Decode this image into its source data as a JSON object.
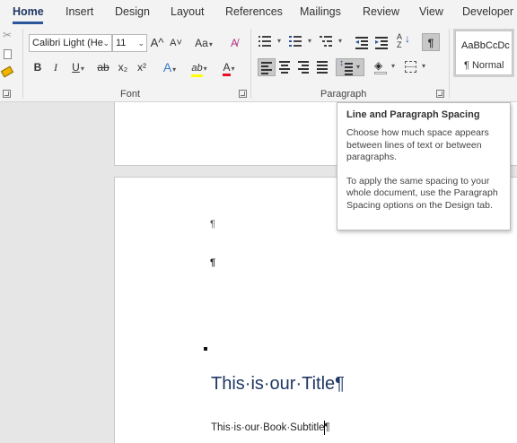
{
  "tabs": [
    "Home",
    "Insert",
    "Design",
    "Layout",
    "References",
    "Mailings",
    "Review",
    "View",
    "Developer"
  ],
  "active_tab": "Home",
  "ribbon": {
    "font": {
      "label": "Font",
      "name_value": "Calibri Light (He",
      "size_value": "11",
      "grow_label": "A^",
      "shrink_label": "A˅",
      "case_label": "Aa",
      "bold": "B",
      "italic": "I",
      "underline": "U",
      "strikethrough": "ab",
      "subscript": "x₂",
      "superscript": "x²",
      "effects": "A",
      "highlight": "ab",
      "font_color": "A"
    },
    "paragraph": {
      "label": "Paragraph",
      "show_marks": "¶"
    },
    "styles": {
      "sample": "AaBbCcDc",
      "name": "¶ Normal"
    }
  },
  "document": {
    "empty_marks": [
      "¶",
      "¶"
    ],
    "title": "This·is·our·Title¶",
    "subtitle": "This·is·our·Book·Subtitle¶"
  },
  "tooltip": {
    "title": "Line and Paragraph Spacing",
    "body1": "Choose how much space appears between lines of text or between paragraphs.",
    "body2": "To apply the same spacing to your whole document, use the Paragraph Spacing options on the Design tab."
  },
  "colors": {
    "accent": "#2b579a",
    "title": "#1f3864",
    "highlight": "#ffff00",
    "font_color": "#e81123"
  }
}
